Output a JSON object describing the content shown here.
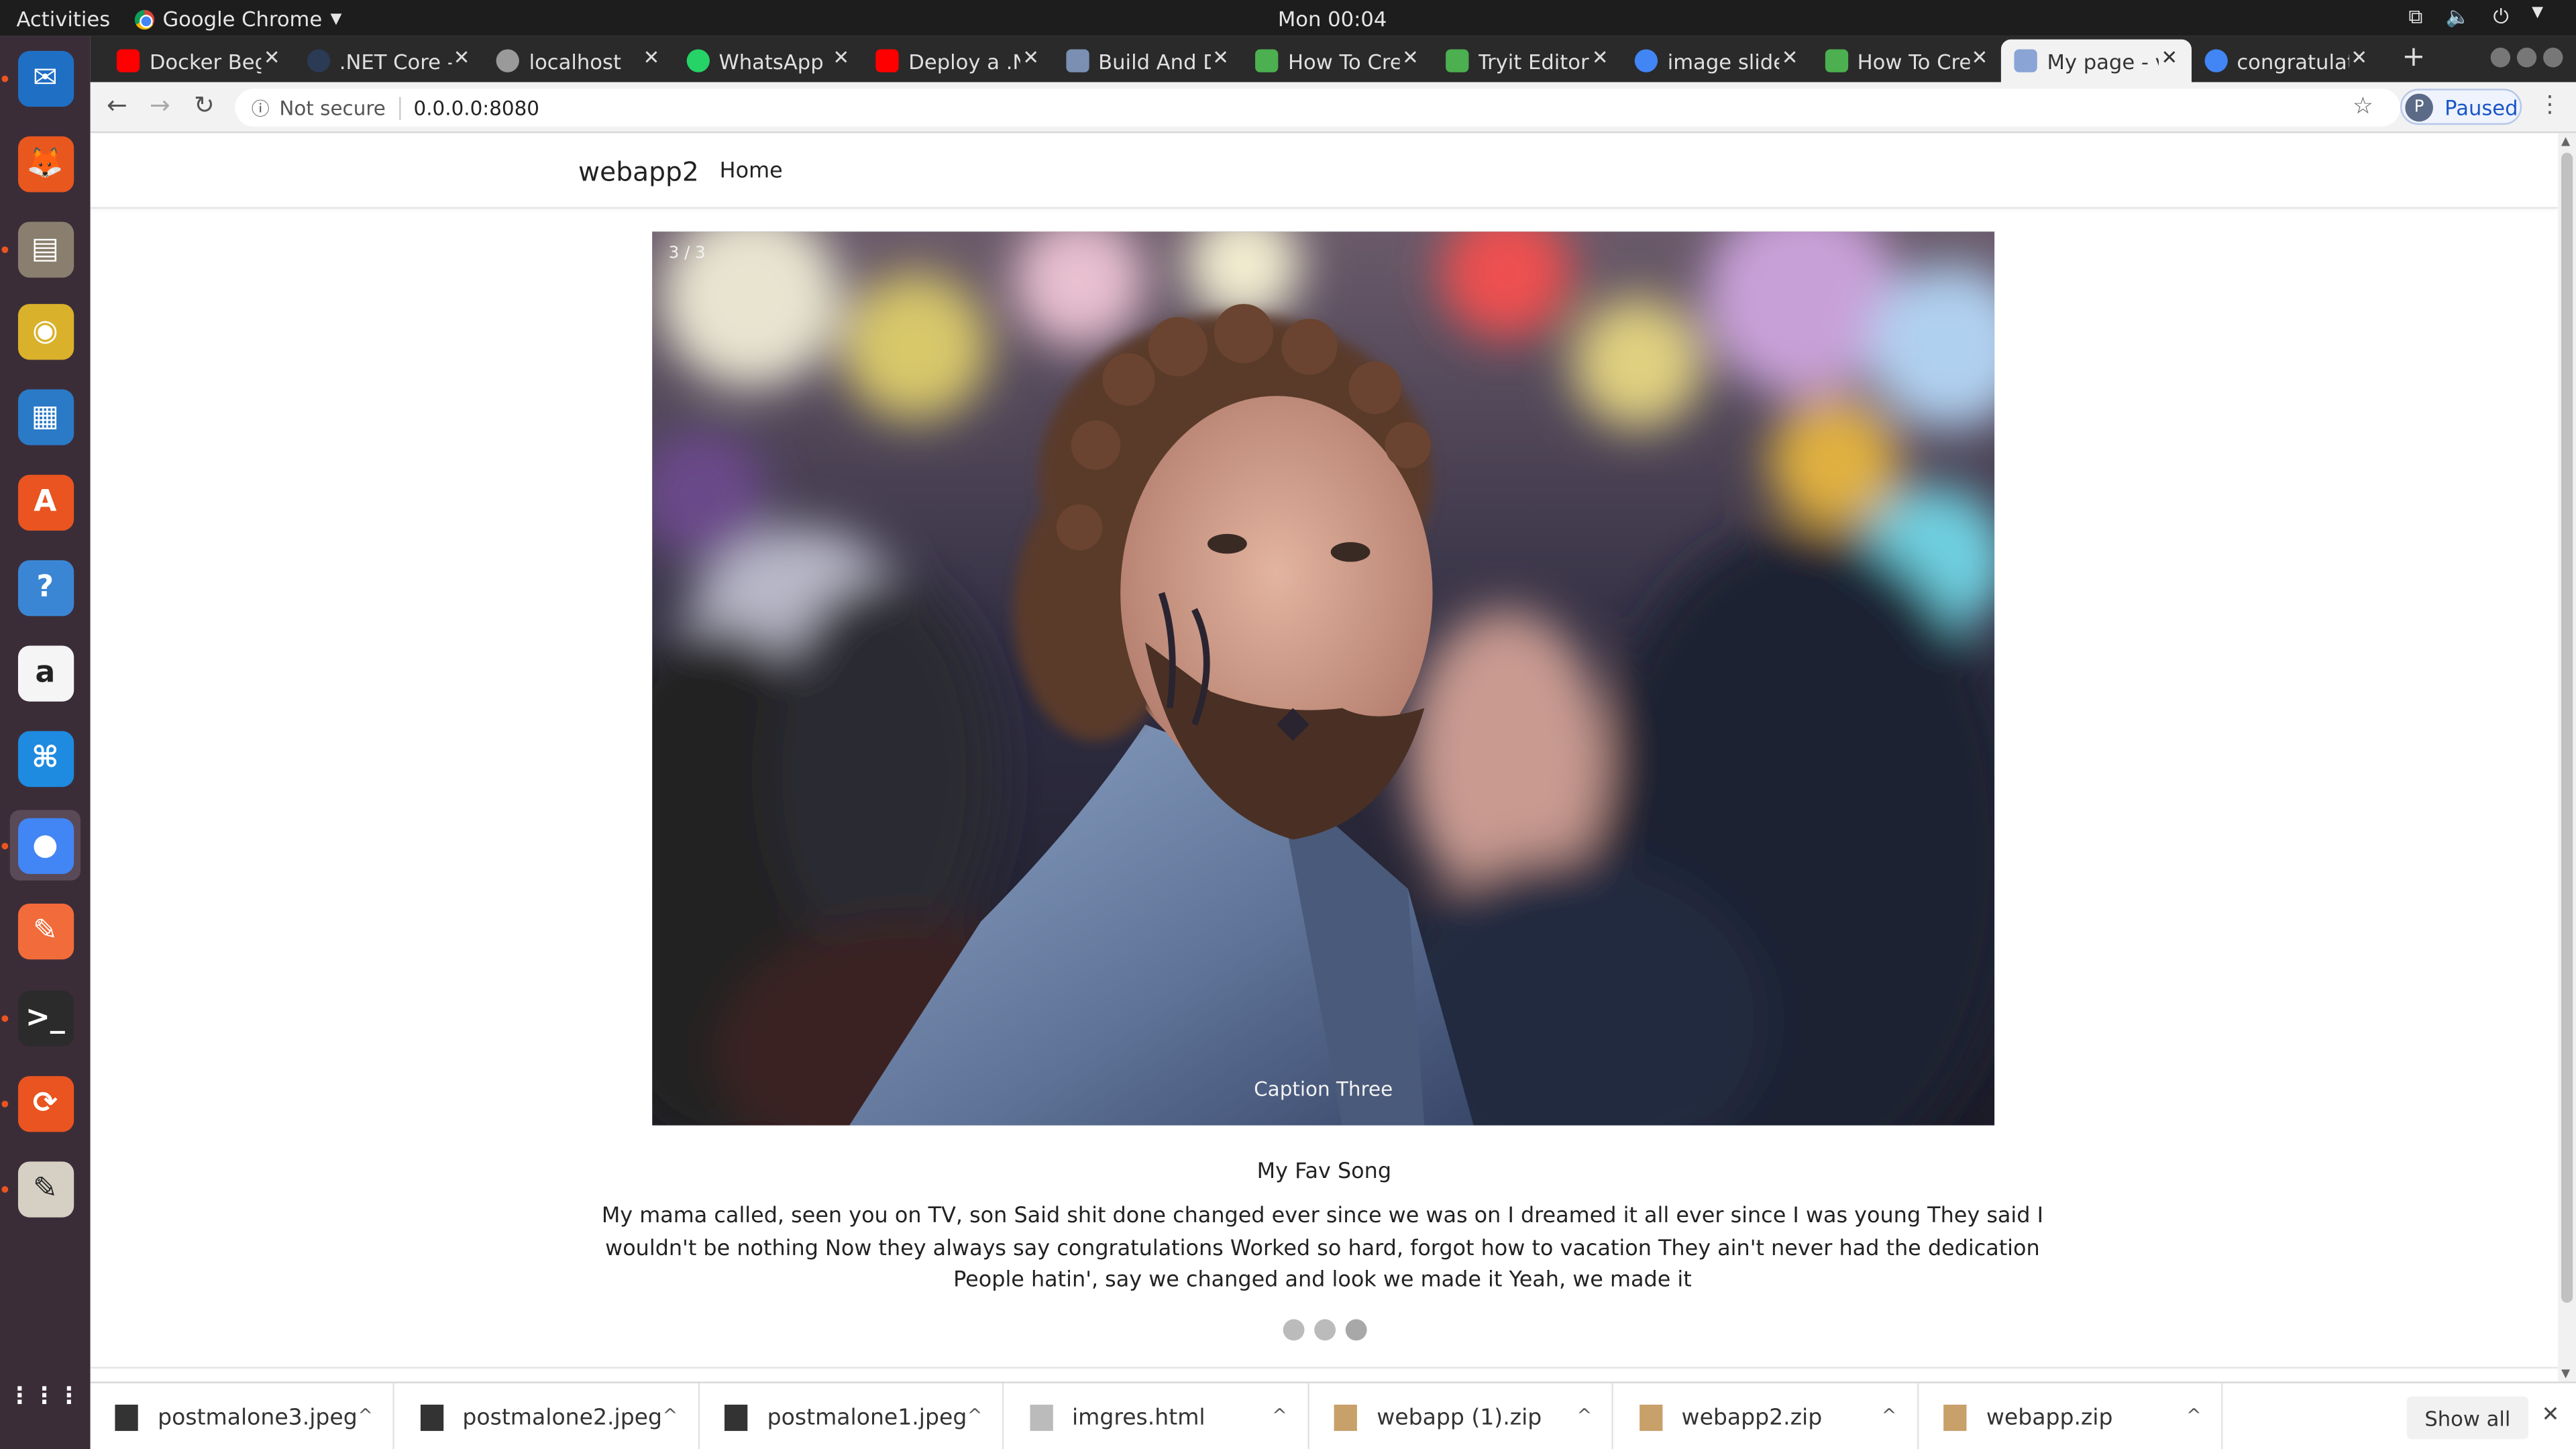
{
  "system": {
    "activities": "Activities",
    "app_name": "Google Chrome",
    "clock": "Mon 00:04"
  },
  "dock": {
    "items": [
      {
        "name": "thunderbird-icon",
        "color": "#1f6fc5"
      },
      {
        "name": "firefox-icon",
        "color": "#e8571e"
      },
      {
        "name": "files-icon",
        "color": "#8a7f6e"
      },
      {
        "name": "rhythmbox-icon",
        "color": "#d9b12b"
      },
      {
        "name": "libreoffice-impress-icon",
        "color": "#2a7ac7"
      },
      {
        "name": "software-center-icon",
        "color": "#e95420"
      },
      {
        "name": "help-icon",
        "color": "#3a86d4"
      },
      {
        "name": "amazon-icon",
        "color": "#f5f5f5"
      },
      {
        "name": "vscode-icon",
        "color": "#1e8ae0"
      },
      {
        "name": "chrome-icon",
        "color": "#4285f4"
      },
      {
        "name": "postman-icon",
        "color": "#f26b3a"
      },
      {
        "name": "terminal-icon",
        "color": "#2b2b2b"
      },
      {
        "name": "software-updater-icon",
        "color": "#e95420"
      },
      {
        "name": "text-editor-icon",
        "color": "#d6d0c4"
      },
      {
        "name": "app-grid-icon",
        "color": "#ffffff"
      }
    ]
  },
  "browser": {
    "tabs": [
      {
        "label": "Docker Beg",
        "icon": "youtube-icon",
        "color": "#ff0000"
      },
      {
        "label": ".NET Core -",
        "icon": "dotnet-icon",
        "color": "#2b3a55"
      },
      {
        "label": "localhost",
        "icon": "globe-icon",
        "color": "#9a9a9a"
      },
      {
        "label": "WhatsApp",
        "icon": "whatsapp-icon",
        "color": "#25d366"
      },
      {
        "label": "Deploy a .N",
        "icon": "youtube-icon",
        "color": "#ff0000"
      },
      {
        "label": "Build And D",
        "icon": "app-icon",
        "color": "#7b8fb3"
      },
      {
        "label": "How To Cre",
        "icon": "tryit-icon",
        "color": "#4caf50"
      },
      {
        "label": "Tryit Editor",
        "icon": "tryit-icon",
        "color": "#4caf50"
      },
      {
        "label": "image slide",
        "icon": "google-icon",
        "color": "#4285f4"
      },
      {
        "label": "How To Cre",
        "icon": "tryit-icon",
        "color": "#4caf50"
      },
      {
        "label": "My page - v",
        "icon": "page-icon",
        "color": "#8aa4d6"
      },
      {
        "label": "congratulat",
        "icon": "google-icon",
        "color": "#4285f4"
      }
    ],
    "active_tab": 10,
    "security": "Not secure",
    "url": "0.0.0.0:8080",
    "profile_initial": "P",
    "profile_status": "Paused"
  },
  "page": {
    "brand": "webapp2",
    "nav_home": "Home",
    "slide": {
      "counter": "3 / 3",
      "caption": "Caption Three"
    },
    "song_title": "My Fav Song",
    "lyrics": "My mama called, seen you on TV, son Said shit done changed ever since we was on I dreamed it all ever since I was young They said I wouldn't be nothing Now they always say congratulations Worked so hard, forgot how to vacation They ain't never had the dedication People hatin', say we changed and look we made it Yeah, we made it",
    "dots_count": 3,
    "active_dot": 2
  },
  "downloads": {
    "items": [
      {
        "name": "postmalone3.jpeg",
        "type": "image"
      },
      {
        "name": "postmalone2.jpeg",
        "type": "image"
      },
      {
        "name": "postmalone1.jpeg",
        "type": "image"
      },
      {
        "name": "imgres.html",
        "type": "html"
      },
      {
        "name": "webapp (1).zip",
        "type": "zip"
      },
      {
        "name": "webapp2.zip",
        "type": "zip"
      },
      {
        "name": "webapp.zip",
        "type": "zip"
      }
    ],
    "show_all": "Show all"
  }
}
